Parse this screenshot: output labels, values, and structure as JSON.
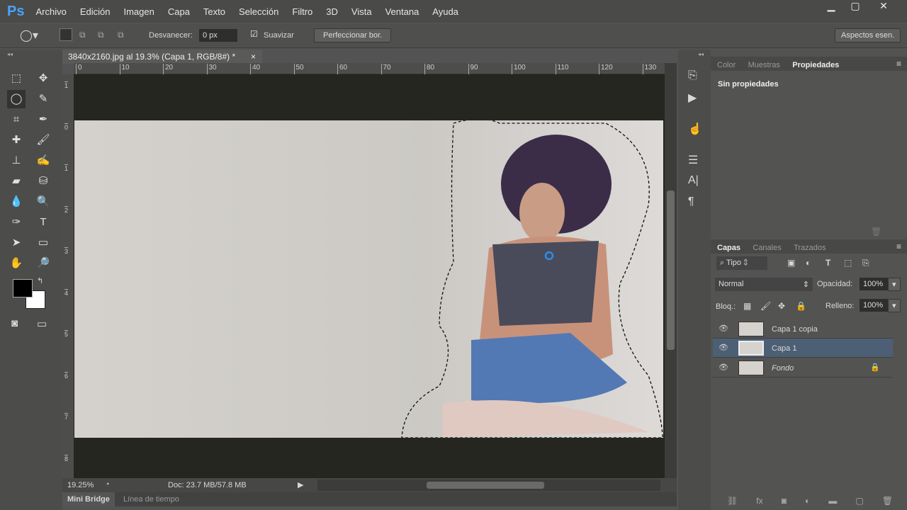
{
  "app": {
    "logo": "Ps",
    "menu": [
      "Archivo",
      "Edición",
      "Imagen",
      "Capa",
      "Texto",
      "Selección",
      "Filtro",
      "3D",
      "Vista",
      "Ventana",
      "Ayuda"
    ]
  },
  "options": {
    "feather_label": "Desvanecer:",
    "feather_value": "0 px",
    "antialias_label": "Suavizar",
    "antialias_checked": true,
    "refine_button": "Perfeccionar bor.",
    "workspace": "Aspectos esen."
  },
  "document": {
    "tab_title": "3840x2160.jpg al 19.3% (Capa 1, RGB/8#) *",
    "h_ruler": [
      "0",
      "10",
      "20",
      "30",
      "40",
      "50",
      "60",
      "70",
      "80",
      "90",
      "100",
      "110",
      "120",
      "130"
    ],
    "v_ruler": [
      "1",
      "0",
      "1",
      "2",
      "3",
      "4",
      "5",
      "6",
      "7",
      "8"
    ]
  },
  "status": {
    "zoom": "19.25%",
    "doc": "Doc: 23.7 MB/57.8 MB"
  },
  "bottom_tabs": [
    "Mini Bridge",
    "Línea de tiempo"
  ],
  "properties": {
    "tabs": [
      "Color",
      "Muestras",
      "Propiedades"
    ],
    "active": "Propiedades",
    "content": "Sin propiedades"
  },
  "layers_panel": {
    "tabs": [
      "Capas",
      "Canales",
      "Trazados"
    ],
    "filter": "Tipo",
    "blend_mode": "Normal",
    "opacity_label": "Opacidad:",
    "opacity": "100%",
    "lock_label": "Bloq.:",
    "fill_label": "Relleno:",
    "fill": "100%",
    "layers": [
      {
        "name": "Capa 1 copia",
        "selected": false
      },
      {
        "name": "Capa 1",
        "selected": true
      },
      {
        "name": "Fondo",
        "selected": false,
        "locked": true
      }
    ]
  },
  "colors": {
    "foreground": "#000000",
    "background": "#ffffff",
    "selected_layer": "#4d5f75"
  }
}
